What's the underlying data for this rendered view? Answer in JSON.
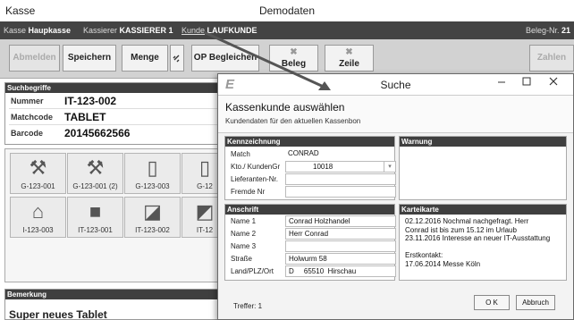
{
  "window": {
    "app_label": "Kasse",
    "title": "Demodaten"
  },
  "infobar": {
    "kasse_label": "Kasse",
    "kasse_value": "Haupkasse",
    "kassierer_label": "Kassierer",
    "kassierer_value": "KASSIERER 1",
    "kunde_label": "Kunde",
    "kunde_value": "LAUFKUNDE",
    "beleg_label": "Beleg-Nr.",
    "beleg_value": "21"
  },
  "toolbar": {
    "abmelden": "Abmelden",
    "speichern": "Speichern",
    "menge": "Menge",
    "op_begleichen": "OP Begleichen",
    "beleg": "Beleg",
    "zeile": "Zeile",
    "zahlen": "Zahlen",
    "x_mark": "✖"
  },
  "suchbegriffe": {
    "header": "Suchbegriffe",
    "rows": [
      {
        "label": "Nummer",
        "value": "IT-123-002"
      },
      {
        "label": "Matchcode",
        "value": "TABLET"
      },
      {
        "label": "Barcode",
        "value": "20145662566"
      }
    ]
  },
  "tiles": [
    {
      "caption": "G-123-001",
      "icon": "wrench-hammer-icon",
      "glyph": "⚒"
    },
    {
      "caption": "G-123-001 (2)",
      "icon": "wrench-hammer-icon",
      "glyph": "⚒"
    },
    {
      "caption": "G-123-003",
      "icon": "door-icon",
      "glyph": "▯"
    },
    {
      "caption": "G-12",
      "icon": "door-icon",
      "glyph": "▯"
    },
    {
      "caption": "I-123-003",
      "icon": "house-icon",
      "glyph": "⌂"
    },
    {
      "caption": "IT-123-001",
      "icon": "box-icon",
      "glyph": "■"
    },
    {
      "caption": "IT-123-002",
      "icon": "laptop-icon",
      "glyph": "◪"
    },
    {
      "caption": "IT-12",
      "icon": "gadget-icon",
      "glyph": "◩"
    }
  ],
  "bemerkung": {
    "header": "Bemerkung",
    "text": "Super neues Tablet"
  },
  "dialog": {
    "logo": "E",
    "title": "Suche",
    "heading": "Kassenkunde auswählen",
    "subheading": "Kundendaten für den aktuellen Kassenbon",
    "kennzeichnung": {
      "header": "Kennzeichnung",
      "match_label": "Match",
      "match_value": "CONRAD",
      "kto_label": "Kto./ KundenGr",
      "kto_value": "10018",
      "lieferanten_label": "Lieferanten-Nr.",
      "lieferanten_value": "",
      "fremde_label": "Fremde Nr",
      "fremde_value": ""
    },
    "anschrift": {
      "header": "Anschrift",
      "name1_label": "Name 1",
      "name1_value": "Conrad Holzhandel",
      "name2_label": "Name 2",
      "name2_value": "Herr Conrad",
      "name3_label": "Name 3",
      "name3_value": "",
      "strasse_label": "Straße",
      "strasse_value": "Holwurm 58",
      "ort_label": "Land/PLZ/Ort",
      "ort_value": "D     65510  Hirschau"
    },
    "warnung": {
      "header": "Warnung",
      "text": ""
    },
    "karteikarte": {
      "header": "Karteikarte",
      "lines": [
        "02.12.2016 Nochmal nachgefragt. Herr",
        "Conrad ist bis zum 15.12 im Urlaub",
        "23.11.2016 Interesse an neuer IT-Ausstattung",
        "",
        "Erstkontakt:",
        "17.06.2014 Messe Köln"
      ]
    },
    "treffer": "Treffer: 1",
    "ok": "O K",
    "abbruch": "Abbruch"
  }
}
